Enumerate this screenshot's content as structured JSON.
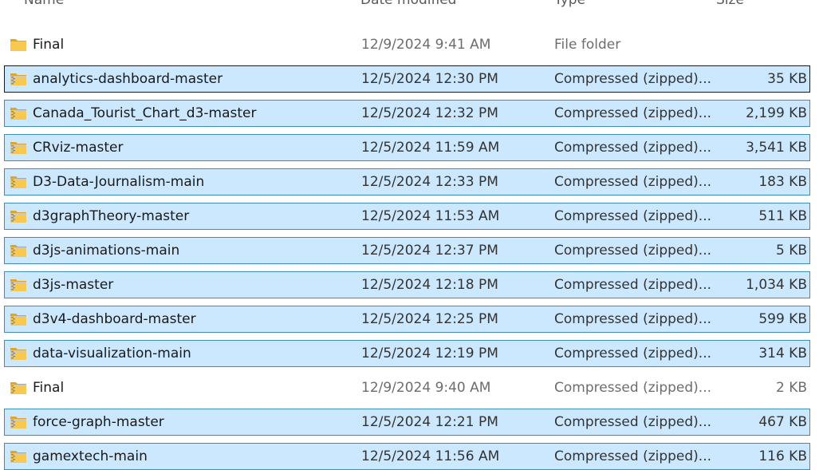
{
  "header": {
    "name": "Name",
    "date": "Date modified",
    "type": "Type",
    "size": "Size"
  },
  "files": [
    {
      "name": "Final",
      "date": "12/9/2024 9:41 AM",
      "type": "File folder",
      "size": "",
      "icon": "folder-icon",
      "selected": false,
      "focused": false
    },
    {
      "name": "analytics-dashboard-master",
      "date": "12/5/2024 12:30 PM",
      "type": "Compressed (zipped)...",
      "size": "35 KB",
      "icon": "zip-folder-icon",
      "selected": true,
      "focused": true
    },
    {
      "name": "Canada_Tourist_Chart_d3-master",
      "date": "12/5/2024 12:32 PM",
      "type": "Compressed (zipped)...",
      "size": "2,199 KB",
      "icon": "zip-folder-icon",
      "selected": true,
      "focused": false
    },
    {
      "name": "CRviz-master",
      "date": "12/5/2024 11:59 AM",
      "type": "Compressed (zipped)...",
      "size": "3,541 KB",
      "icon": "zip-folder-icon",
      "selected": true,
      "focused": false
    },
    {
      "name": "D3-Data-Journalism-main",
      "date": "12/5/2024 12:33 PM",
      "type": "Compressed (zipped)...",
      "size": "183 KB",
      "icon": "zip-folder-icon",
      "selected": true,
      "focused": false
    },
    {
      "name": "d3graphTheory-master",
      "date": "12/5/2024 11:53 AM",
      "type": "Compressed (zipped)...",
      "size": "511 KB",
      "icon": "zip-folder-icon",
      "selected": true,
      "focused": false
    },
    {
      "name": "d3js-animations-main",
      "date": "12/5/2024 12:37 PM",
      "type": "Compressed (zipped)...",
      "size": "5 KB",
      "icon": "zip-folder-icon",
      "selected": true,
      "focused": false
    },
    {
      "name": "d3js-master",
      "date": "12/5/2024 12:18 PM",
      "type": "Compressed (zipped)...",
      "size": "1,034 KB",
      "icon": "zip-folder-icon",
      "selected": true,
      "focused": false
    },
    {
      "name": "d3v4-dashboard-master",
      "date": "12/5/2024 12:25 PM",
      "type": "Compressed (zipped)...",
      "size": "599 KB",
      "icon": "zip-folder-icon",
      "selected": true,
      "focused": false
    },
    {
      "name": "data-visualization-main",
      "date": "12/5/2024 12:19 PM",
      "type": "Compressed (zipped)...",
      "size": "314 KB",
      "icon": "zip-folder-icon",
      "selected": true,
      "focused": false
    },
    {
      "name": "Final",
      "date": "12/9/2024 9:40 AM",
      "type": "Compressed (zipped)...",
      "size": "2 KB",
      "icon": "zip-folder-icon",
      "selected": false,
      "focused": false
    },
    {
      "name": "force-graph-master",
      "date": "12/5/2024 12:21 PM",
      "type": "Compressed (zipped)...",
      "size": "467 KB",
      "icon": "zip-folder-icon",
      "selected": true,
      "focused": false
    },
    {
      "name": "gamextech-main",
      "date": "12/5/2024 11:56 AM",
      "type": "Compressed (zipped)...",
      "size": "116 KB",
      "icon": "zip-folder-icon",
      "selected": true,
      "focused": false
    }
  ],
  "colors": {
    "selection_bg": "#cce8ff",
    "selection_border": "#3d8fb8",
    "folder_yellow": "#f8c94e",
    "zipper": "#8a8a8a"
  }
}
